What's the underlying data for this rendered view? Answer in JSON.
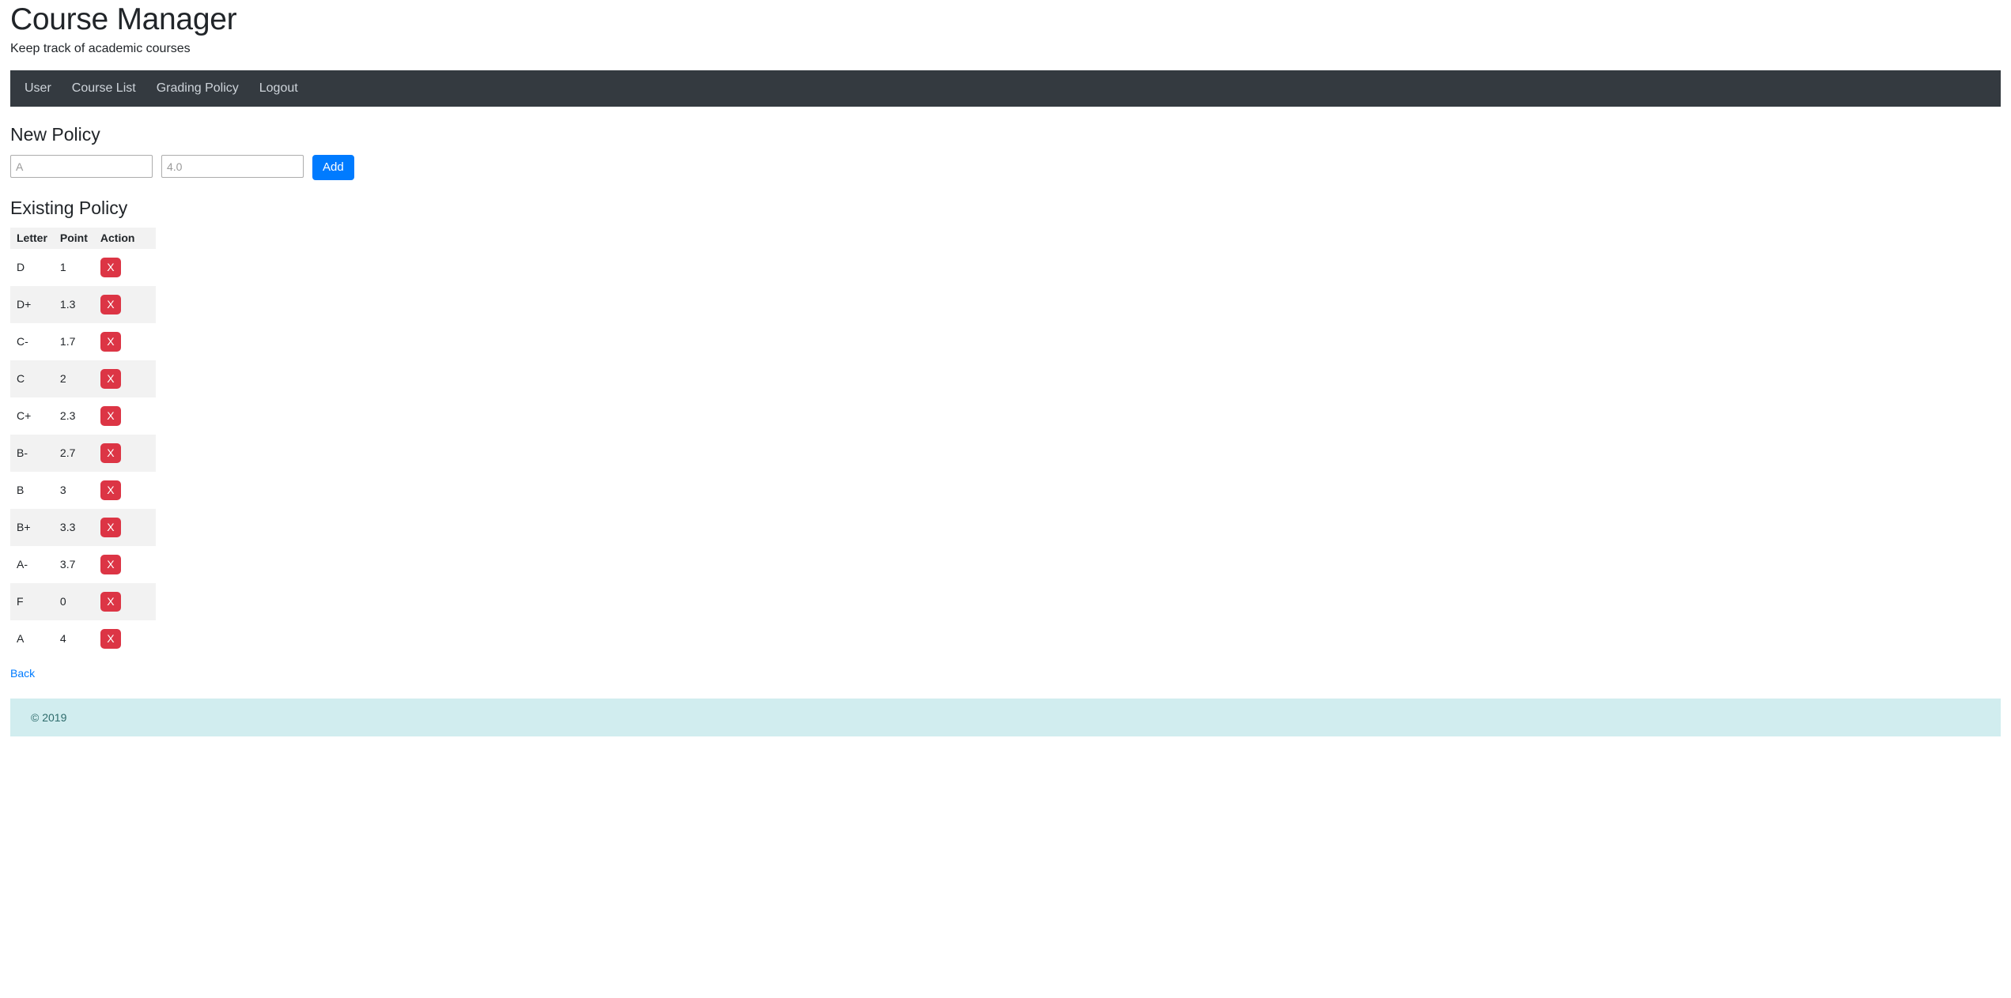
{
  "header": {
    "title": "Course Manager",
    "subtitle": "Keep track of academic courses"
  },
  "nav": {
    "items": [
      {
        "label": "User"
      },
      {
        "label": "Course List"
      },
      {
        "label": "Grading Policy"
      },
      {
        "label": "Logout"
      }
    ]
  },
  "new_policy": {
    "heading": "New Policy",
    "letter_input": {
      "value": "",
      "placeholder": "A"
    },
    "point_input": {
      "value": "",
      "placeholder": "4.0"
    },
    "add_button": "Add"
  },
  "existing_policy": {
    "heading": "Existing Policy",
    "columns": [
      "Letter",
      "Point",
      "Action"
    ],
    "delete_label": "X",
    "rows": [
      {
        "letter": "D",
        "point": "1"
      },
      {
        "letter": "D+",
        "point": "1.3"
      },
      {
        "letter": "C-",
        "point": "1.7"
      },
      {
        "letter": "C",
        "point": "2"
      },
      {
        "letter": "C+",
        "point": "2.3"
      },
      {
        "letter": "B-",
        "point": "2.7"
      },
      {
        "letter": "B",
        "point": "3"
      },
      {
        "letter": "B+",
        "point": "3.3"
      },
      {
        "letter": "A-",
        "point": "3.7"
      },
      {
        "letter": "F",
        "point": "0"
      },
      {
        "letter": "A",
        "point": "4"
      }
    ]
  },
  "back_link": "Back",
  "footer": {
    "text": "© 2019"
  },
  "colors": {
    "navbar_bg": "#343a40",
    "primary": "#007bff",
    "danger": "#dc3545",
    "footer_bg": "#d1edef",
    "stripe": "#f2f2f2"
  }
}
